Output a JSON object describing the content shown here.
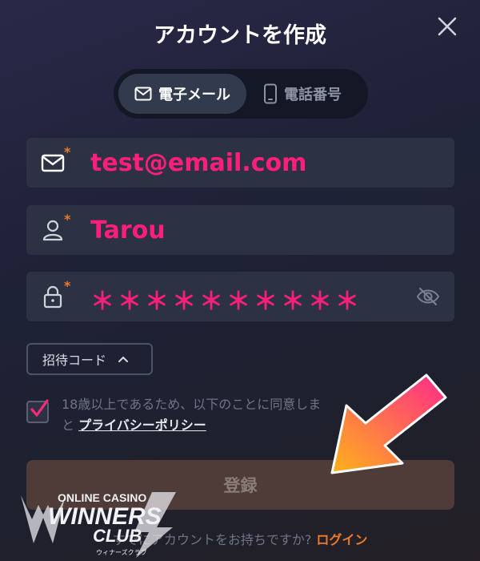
{
  "header": {
    "title": "アカウントを作成"
  },
  "tabs": [
    {
      "label": "電子メール",
      "icon": "mail-icon",
      "active": true
    },
    {
      "label": "電話番号",
      "icon": "phone-icon",
      "active": false
    }
  ],
  "form": {
    "email": {
      "value": "test@email.com",
      "required": "*"
    },
    "username": {
      "value": "Tarou",
      "required": "*"
    },
    "password": {
      "value": "＊＊＊＊＊＊＊＊＊＊",
      "required": "*"
    }
  },
  "invite": {
    "label": "招待コード"
  },
  "agreement": {
    "checked": true,
    "text_before": "18歳以上であるため、以下のことに同意しま",
    "text_conj": "と ",
    "link": "プライバシーポリシー"
  },
  "submit": {
    "label": "登録"
  },
  "footer": {
    "prompt": "すでにアカウントをお持ちですか?",
    "login_label": "ログイン"
  },
  "watermark": {
    "line1": "ONLINE CASINO",
    "line2": "WINNERS",
    "line3": "CLUB",
    "line4": "ウィナーズクラブ"
  },
  "colors": {
    "accent": "#f07a28",
    "value_pink": "#ff1f7a",
    "checkbox_pink": "#ff2a7a",
    "background": "#1d2131"
  }
}
